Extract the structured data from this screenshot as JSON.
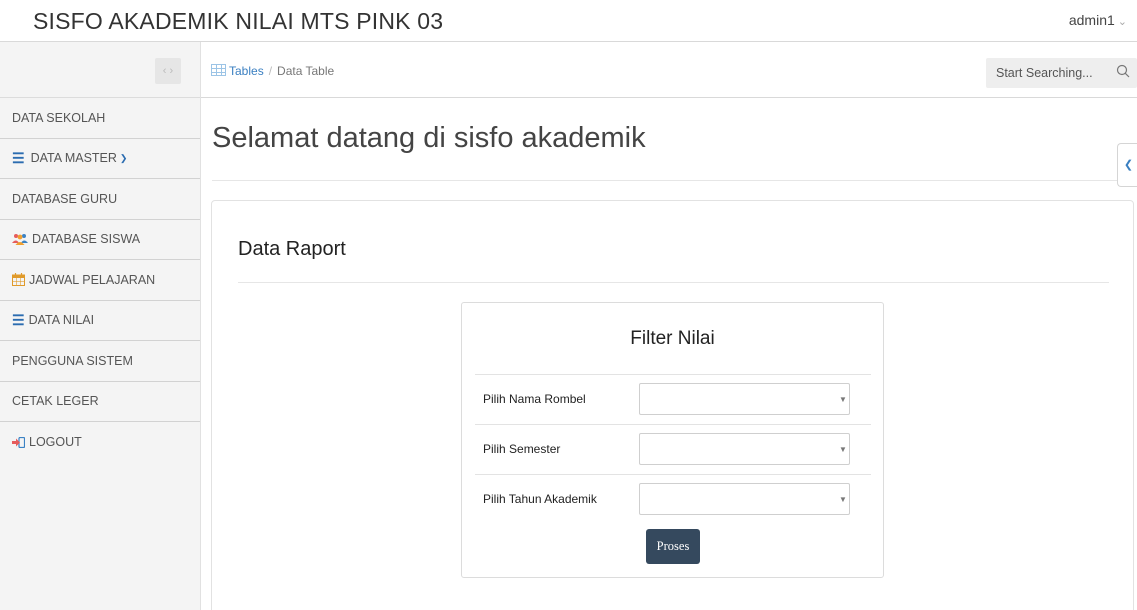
{
  "header": {
    "app_title": "SISFO AKADEMIK NILAI MTS PINK 03",
    "user": "admin1"
  },
  "sidebar": {
    "items": [
      {
        "label": "DATA SEKOLAH",
        "icon": ""
      },
      {
        "label": "DATA MASTER",
        "icon": "bars-icon",
        "has_caret": true
      },
      {
        "label": "DATABASE GURU",
        "icon": ""
      },
      {
        "label": "DATABASE SISWA",
        "icon": "users-icon"
      },
      {
        "label": "JADWAL PELAJARAN",
        "icon": "calendar-icon"
      },
      {
        "label": "DATA NILAI",
        "icon": "bars-icon"
      },
      {
        "label": "PENGGUNA SISTEM",
        "icon": ""
      },
      {
        "label": "CETAK LEGER",
        "icon": ""
      },
      {
        "label": "LOGOUT",
        "icon": "logout-icon"
      }
    ]
  },
  "breadcrumb": {
    "root": "Tables",
    "separator": "/",
    "current": "Data Table"
  },
  "search": {
    "placeholder": "Start Searching..."
  },
  "main": {
    "page_title": "Selamat datang di sisfo akademik",
    "panel_title": "Data Raport",
    "filter": {
      "title": "Filter Nilai",
      "fields": [
        {
          "label": "Pilih Nama Rombel",
          "value": ""
        },
        {
          "label": "Pilih Semester",
          "value": ""
        },
        {
          "label": "Pilih Tahun Akademik",
          "value": ""
        }
      ],
      "submit_label": "Proses"
    }
  },
  "colors": {
    "accent_blue": "#3a7fc1",
    "button_dark": "#35495e",
    "sidebar_bg": "#f4f4f4"
  }
}
